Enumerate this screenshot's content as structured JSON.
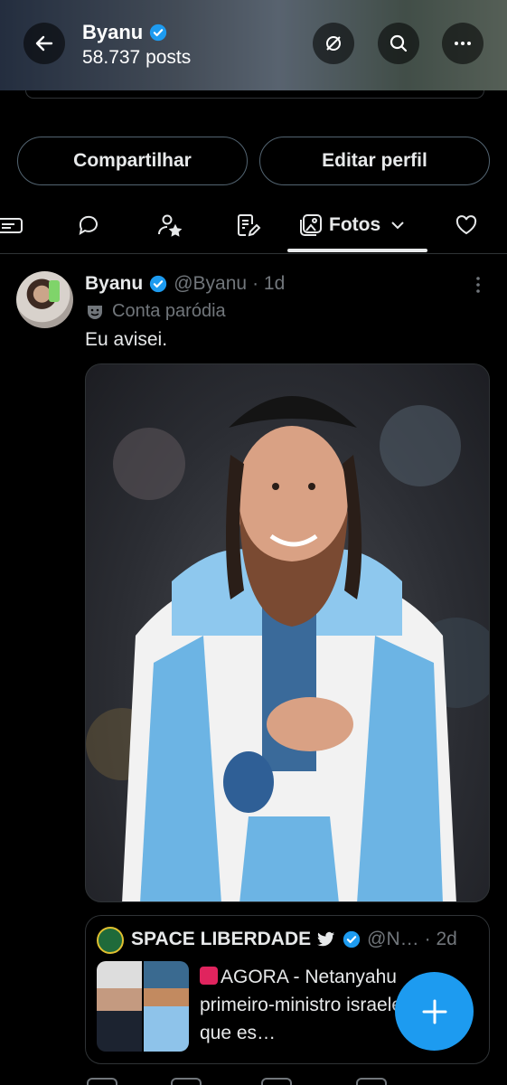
{
  "header": {
    "title": "Byanu",
    "posts_count": "58.737 posts"
  },
  "profile_actions": {
    "share_label": "Compartilhar",
    "edit_label": "Editar perfil"
  },
  "tabs": {
    "active_label": "Fotos"
  },
  "post": {
    "author_name": "Byanu",
    "author_handle": "@Byanu",
    "time": "· 1d",
    "parody_label": "Conta paródia",
    "text": "Eu avisei."
  },
  "quote": {
    "author_name": "SPACE LIBERDADE",
    "author_handle": "@N…",
    "time": "· 2d",
    "text": "AGORA - Netanyahu primeiro-ministro israelense, diz que es…"
  },
  "colors": {
    "accent": "#1d9bf0",
    "background": "#000000",
    "secondary_text": "#71767b"
  }
}
